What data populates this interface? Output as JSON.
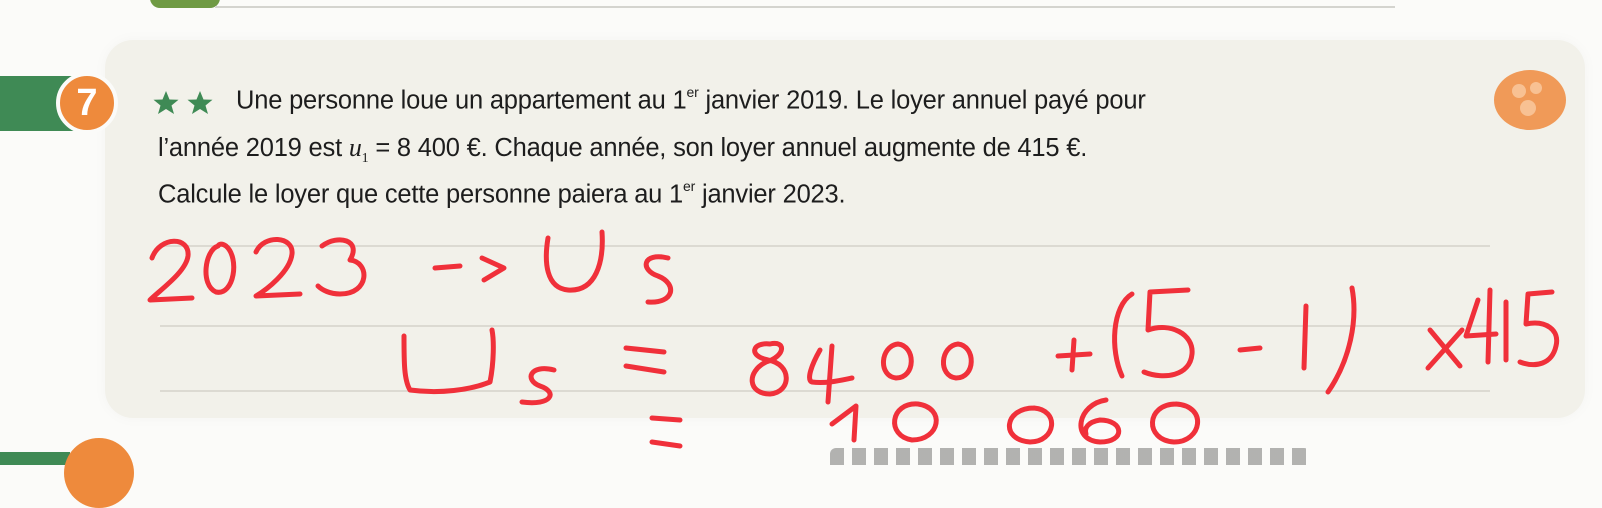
{
  "exercise": {
    "number": "7",
    "difficulty_icon": "two-stars-icon",
    "lines": [
      {
        "text_before": "Une personne loue un appartement au 1",
        "sup": "er",
        "text_after": " janvier 2019. Le loyer annuel payé pour"
      },
      {
        "text_before": "l’année 2019 est ",
        "math_var": "u",
        "math_sub": "1",
        "text_after": " = 8 400 €. Chaque année, son loyer annuel augmente de 415 €."
      },
      {
        "text_before": "Calcule le loyer que cette personne paiera au 1",
        "sup": "er",
        "text_after": " janvier 2023."
      }
    ]
  },
  "handwritten_answer": {
    "ink_color": "#f0303a",
    "line1": "2023 -> U5",
    "line2": "U5 = 8400 + (5-1) x415",
    "line3": "= 10060"
  },
  "colors": {
    "badge_orange": "#ee8a3c",
    "strip_green": "#3f8a55",
    "card_background": "#f2f1ea",
    "star_green": "#3f8a55"
  }
}
